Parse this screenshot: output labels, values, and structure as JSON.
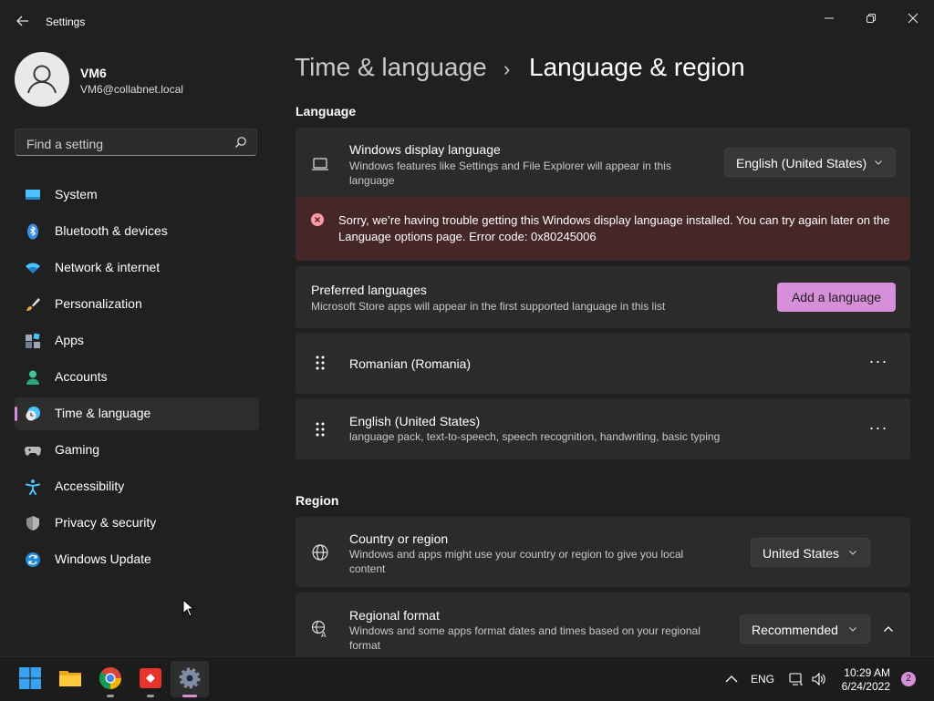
{
  "window": {
    "title": "Settings",
    "controls": [
      "minimize",
      "maximize",
      "close"
    ]
  },
  "user": {
    "name": "VM6",
    "email": "VM6@collabnet.local"
  },
  "search": {
    "placeholder": "Find a setting"
  },
  "sidebar": {
    "items": [
      {
        "label": "System",
        "icon": "system-icon"
      },
      {
        "label": "Bluetooth & devices",
        "icon": "bluetooth-icon"
      },
      {
        "label": "Network & internet",
        "icon": "wifi-icon"
      },
      {
        "label": "Personalization",
        "icon": "brush-icon"
      },
      {
        "label": "Apps",
        "icon": "apps-icon"
      },
      {
        "label": "Accounts",
        "icon": "accounts-icon"
      },
      {
        "label": "Time & language",
        "icon": "clock-globe-icon",
        "selected": true
      },
      {
        "label": "Gaming",
        "icon": "gamepad-icon"
      },
      {
        "label": "Accessibility",
        "icon": "accessibility-icon"
      },
      {
        "label": "Privacy & security",
        "icon": "shield-icon"
      },
      {
        "label": "Windows Update",
        "icon": "update-icon"
      }
    ]
  },
  "breadcrumb": {
    "parent": "Time & language",
    "separator": "›",
    "current": "Language & region"
  },
  "language": {
    "heading": "Language",
    "display": {
      "title": "Windows display language",
      "subtitle": "Windows features like Settings and File Explorer will appear in this language",
      "value": "English (United States)"
    },
    "error": {
      "message": "Sorry, we’re having trouble getting this Windows display language installed. You can try again later on the Language options page. Error code: 0x80245006"
    },
    "preferred": {
      "title": "Preferred languages",
      "subtitle": "Microsoft Store apps will appear in the first supported language in this list",
      "add_label": "Add a language"
    },
    "list": [
      {
        "name": "Romanian (Romania)",
        "features": ""
      },
      {
        "name": "English (United States)",
        "features": "language pack, text-to-speech, speech recognition, handwriting, basic typing"
      }
    ],
    "more_label": "···"
  },
  "region": {
    "heading": "Region",
    "country": {
      "title": "Country or region",
      "subtitle": "Windows and apps might use your country or region to give you local content",
      "value": "United States"
    },
    "format": {
      "title": "Regional format",
      "subtitle": "Windows and some apps format dates and times based on your regional format",
      "value": "Recommended"
    }
  },
  "taskbar": {
    "apps": [
      "start-icon",
      "file-explorer-icon",
      "chrome-icon",
      "remote-app-icon",
      "settings-icon"
    ],
    "input_language": "ENG",
    "time": "10:29 AM",
    "date": "6/24/2022",
    "notifications": "2"
  },
  "colors": {
    "accent": "#d88fda",
    "background": "#202020",
    "card": "#2b2b2b",
    "error_background": "#442726",
    "error_icon": "#ff99a4"
  }
}
